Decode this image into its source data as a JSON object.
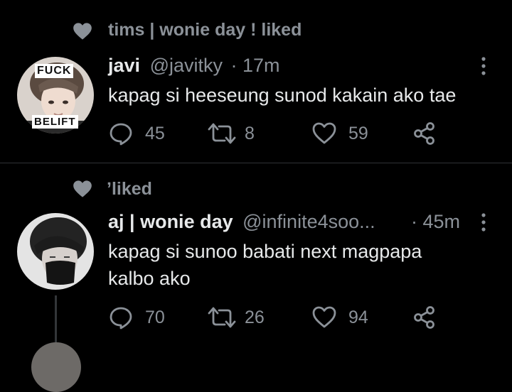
{
  "tweets": [
    {
      "context": "tims | wonie day ! liked",
      "name": "javi",
      "handle": "@javitky",
      "time": "· 17m",
      "text_lines": [
        "kapag si heeseung sunod kakain ako tae"
      ],
      "avatar": {
        "top_text": "FUCK",
        "bottom_text": "BELIFT"
      },
      "replies": "45",
      "retweets": "8",
      "likes": "59"
    },
    {
      "context": "ʼliked",
      "name": "aj | wonie day",
      "handle": "@infinite4soo...",
      "time": "· 45m",
      "text_lines": [
        "kapag si sunoo babati next magpapa",
        "kalbo ako"
      ],
      "replies": "70",
      "retweets": "26",
      "likes": "94"
    }
  ],
  "colors": {
    "background": "#000000",
    "primary_text": "#e7e9ea",
    "secondary_text": "#8b9198",
    "divider": "#2f3336"
  },
  "icons": [
    "heart-icon",
    "more-icon",
    "reply-icon",
    "retweet-icon",
    "like-icon",
    "share-icon"
  ]
}
